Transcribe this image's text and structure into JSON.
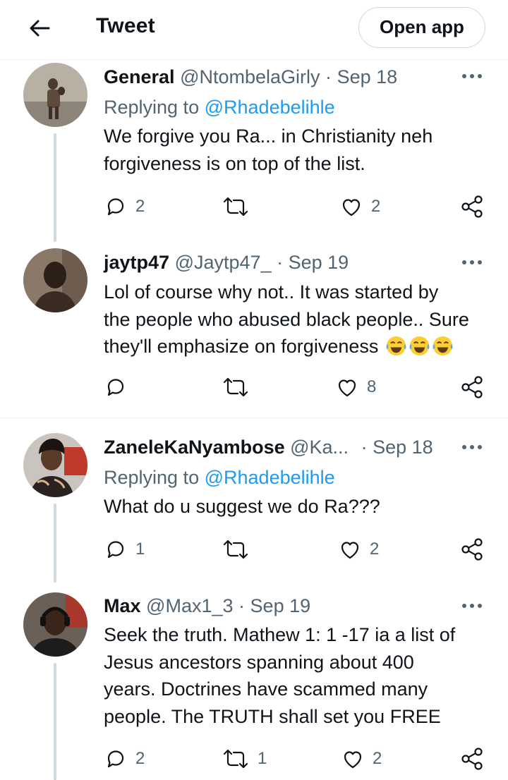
{
  "header": {
    "title": "Tweet",
    "open_app": "Open app"
  },
  "tweets": [
    {
      "name": "General",
      "handle": "@NtombelaGirly",
      "sep": "·",
      "date": "Sep 18",
      "replying_prefix": "Replying to",
      "replying_handle": "@Rhadebelihle",
      "text_lines": [
        "We forgive you Ra... in Christianity neh",
        "forgiveness is on top of the list."
      ],
      "replies": "2",
      "retweets": "",
      "likes": "2"
    },
    {
      "name": "jaytp47",
      "handle": "@Jaytp47_",
      "sep": "·",
      "date": "Sep 19",
      "text_lines": [
        "Lol of course why not.. It was started by",
        "the people who abused black people.. Sure",
        "they'll emphasize on forgiveness"
      ],
      "emojis": [
        "tears-of-joy",
        "tears-of-joy",
        "tears-of-joy"
      ],
      "replies": "",
      "retweets": "",
      "likes": "8"
    },
    {
      "name": "ZaneleKaNyambose",
      "handle": "@Ka...",
      "sep": "·",
      "date": "Sep 18",
      "replying_prefix": "Replying to",
      "replying_handle": "@Rhadebelihle",
      "text_lines": [
        "What do u suggest we do Ra???"
      ],
      "replies": "1",
      "retweets": "",
      "likes": "2"
    },
    {
      "name": "Max",
      "handle": "@Max1_3",
      "sep": "·",
      "date": "Sep 19",
      "text_lines": [
        "Seek the truth. Mathew 1: 1 -17 ia a list of",
        "Jesus ancestors spanning about 400",
        "years. Doctrines have scammed many",
        "people. The TRUTH shall set you FREE"
      ],
      "replies": "2",
      "retweets": "1",
      "likes": "2"
    }
  ],
  "icons": {
    "back": "arrow-left-icon",
    "more": "more-dots-icon",
    "reply": "reply-bubble-icon",
    "retweet": "retweet-icon",
    "like": "heart-icon",
    "share": "share-icon"
  },
  "colors": {
    "link": "#1d9bf0",
    "text": "#0f1419",
    "secondary": "#536471",
    "thread": "#cfd9de"
  }
}
